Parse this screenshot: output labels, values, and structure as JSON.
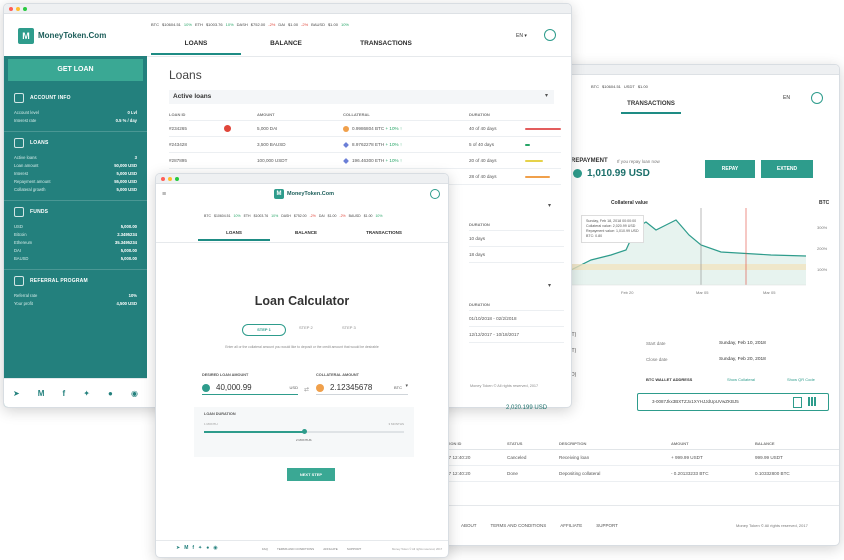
{
  "brand": {
    "name": "MoneyToken.Com",
    "accent": "#23807d",
    "button": "#2e9c8c",
    "positive": "#27a567",
    "negative": "#e0463a"
  },
  "ticker": [
    {
      "sym": "BTC",
      "price": "$10604.51",
      "chg": "10%",
      "dir": "pos"
    },
    {
      "sym": "ETH",
      "price": "$1003.76",
      "chg": "10%",
      "dir": "pos"
    },
    {
      "sym": "DASH",
      "price": "$752.00",
      "chg": "-2%",
      "dir": "neg"
    },
    {
      "sym": "DAI",
      "price": "$1.00",
      "chg": "-2%",
      "dir": "neg"
    },
    {
      "sym": "BAUSD",
      "price": "$1.00",
      "chg": "10%",
      "dir": "pos"
    }
  ],
  "language": "EN",
  "nav_tabs": [
    "LOANS",
    "BALANCE",
    "TRANSACTIONS"
  ],
  "sidebar": {
    "get_loan": "GET LOAN",
    "account": {
      "title": "ACCOUNT INFO",
      "rows": [
        {
          "k": "Account level",
          "v": "0 Lvl"
        },
        {
          "k": "Interest rate",
          "v": "0.5 % / day"
        }
      ]
    },
    "loans": {
      "title": "LOANS",
      "rows": [
        {
          "k": "Active loans",
          "v": "3"
        },
        {
          "k": "Loan amount",
          "v": "50,000 USD"
        },
        {
          "k": "Interest",
          "v": "5,000 USD"
        },
        {
          "k": "Repayment amount",
          "v": "55,000 USD"
        },
        {
          "k": "Collateral growth",
          "v": "5,000 USD"
        }
      ]
    },
    "funds": {
      "title": "FUNDS",
      "rows": [
        {
          "k": "USD",
          "v": "5,000.00"
        },
        {
          "k": "Bitcoin",
          "v": "2.3495234"
        },
        {
          "k": "Ethereum",
          "v": "35.3495234"
        },
        {
          "k": "DAI",
          "v": "5,000.00"
        },
        {
          "k": "BAUSD",
          "v": "5,000.00"
        }
      ]
    },
    "referral": {
      "title": "REFERRAL PROGRAM",
      "rows": [
        {
          "k": "Referral rate",
          "v": "10%"
        },
        {
          "k": "Your profit",
          "v": "4,500 USD"
        }
      ]
    }
  },
  "loans_page": {
    "title": "Loans",
    "active_title": "Active loans",
    "headers": [
      "LOAN ID",
      "AMOUNT",
      "COLLATERAL",
      "DURATION"
    ],
    "rows": [
      {
        "id": "#234265",
        "amount": "5,000 DAI",
        "collateral": "0.9986804 BTC",
        "growth": "+ 10% ↑",
        "duration": "40 of 40 days",
        "bar": 1.0,
        "barcolor": "#e35d5d",
        "coin": "btc"
      },
      {
        "id": "#243428",
        "amount": "3,500 BAUSD",
        "collateral": "8.9762278 ETH",
        "growth": "+ 10% ↑",
        "duration": "5 of 40 days",
        "bar": 0.13,
        "barcolor": "#27a567",
        "coin": "eth"
      },
      {
        "id": "#287895",
        "amount": "100,000 USDT",
        "collateral": "196.46300 ETH",
        "growth": "+ 10% ↑",
        "duration": "20 of 40 days",
        "bar": 0.5,
        "barcolor": "#e6d24a",
        "coin": "eth"
      },
      {
        "id": "",
        "amount": "",
        "collateral": "",
        "growth": "+ 10% ↑",
        "duration": "28 of 40 days",
        "bar": 0.7,
        "barcolor": "#f0a04b",
        "coin": "eth"
      }
    ],
    "section2_duration_header": "DURATION",
    "section2_rows": [
      "10 days",
      "18 days"
    ],
    "section3_duration_header": "DURATION",
    "section3_rows": [
      "01/10/2018 - 02/2/2018",
      "12/12/2017 - 10/18/2017"
    ],
    "footer": "Money Token © All rights reserved, 2017"
  },
  "calculator": {
    "brand": "MoneyToken.Com",
    "ticker": [
      {
        "sym": "BTC",
        "price": "$10604.51",
        "chg": "10%"
      },
      {
        "sym": "ETH",
        "price": "$1003.76",
        "chg": "10%"
      },
      {
        "sym": "DASH",
        "price": "$752.00",
        "chg": "-2%"
      },
      {
        "sym": "DAI",
        "price": "$1.00",
        "chg": "-2%"
      },
      {
        "sym": "BAUSD",
        "price": "$1.00",
        "chg": "10%"
      }
    ],
    "tabs": [
      "LOANS",
      "BALANCE",
      "TRANSACTIONS"
    ],
    "title": "Loan Calculator",
    "steps": [
      "STEP 1",
      "STEP 2",
      "STEP 3"
    ],
    "hint": "Enter all or the collateral amount you would like to deposit or the credit amount that would be desirable",
    "loan_label": "DESIRED LOAN AMOUNT",
    "loan_value": "40,000.99",
    "loan_currency": "USD",
    "collateral_label": "COLLATERAL AMOUNT",
    "collateral_value": "2.12345678",
    "collateral_currency": "BTC",
    "duration_label": "LOAN DURATION",
    "slider_min": "1 MONTH",
    "slider_max": "3 MONTHS",
    "slider_value": "2 MONTHS",
    "slider_fraction": 0.5,
    "next_button": "NEXT STEP",
    "footer_links": [
      "FAQ",
      "TERMS AND CONDITIONS",
      "AFFILIATE",
      "SUPPORT"
    ],
    "footer_copy": "Money Token © All rights reserved, 2017"
  },
  "transactions_page": {
    "ticker": [
      {
        "sym": "BTC",
        "price": "$10604.51"
      },
      {
        "sym": "USDT",
        "price": "$1.00"
      }
    ],
    "title": "TRANSACTIONS",
    "repayment_label": "REPAYMENT",
    "repayment_hint": "If you repay loan now",
    "repayment_value": "1,010.99 USD",
    "repay_button": "REPAY",
    "extend_button": "EXTEND",
    "chart_label": "Collateral value",
    "chart_tooltip": [
      "Sunday, Feb 18, 2018 00:00:00",
      "Collateral value: 2,020.99 USD",
      "Repayment value: 1,010.99 USD",
      "BTC: 0.80"
    ],
    "chart_btc_label": "BTC",
    "chart_y": [
      "300%",
      "200%",
      "100%"
    ],
    "chart_x": [
      "Feb 20",
      "Mar 05",
      "Mar 05"
    ],
    "details": [
      {
        "k": "Start date",
        "v": "Sunday, Feb 10, 2018"
      },
      {
        "k": "Close date",
        "v": "Sunday, Feb 20, 2018"
      }
    ],
    "left_partial": [
      "USDT)",
      "USDT)",
      "D)"
    ],
    "wallet_label": "BTC WALLET ADDRESS",
    "wallet_copy": "Show Collateral",
    "wallet_qr": "Show QR Code",
    "wallet_address": "3-0087Jkx3BXTZJx1XYHJJdUpUVwZKBJ5",
    "amount_left": "2,020.199 USD",
    "history_headers": [
      "ACTION ID",
      "STATUS",
      "DESCRIPTION",
      "AMOUNT",
      "BALANCE"
    ],
    "history_rows": [
      {
        "date": "2017 12:40:20",
        "status": "Canceled",
        "desc": "Receiving loan",
        "amount": "+ 999.99 USDT",
        "balance": "999.99 USDT"
      },
      {
        "date": "2017 12:40:20",
        "status": "Done",
        "desc": "Depositing collateral",
        "amount": "- 0.20133233 BTC",
        "balance": "0.10332800 BTC"
      }
    ],
    "footer_links": [
      "ABOUT",
      "TERMS AND CONDITIONS",
      "AFFILIATE",
      "SUPPORT"
    ],
    "footer_copy": "Money Token © All rights reserved, 2017"
  }
}
